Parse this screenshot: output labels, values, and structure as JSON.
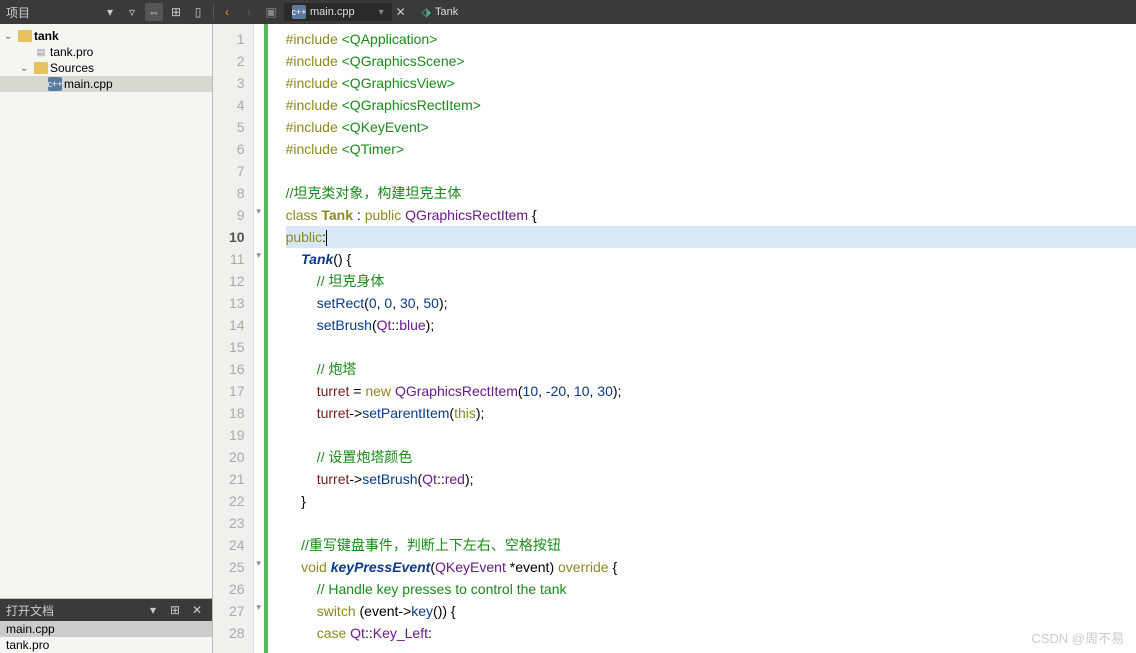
{
  "topbar": {
    "project_label": "项目",
    "nav_back": "‹",
    "nav_fwd": "›",
    "tabs": [
      {
        "icon": "cpp",
        "label": "main.cpp"
      }
    ],
    "symbol_label": "Tank"
  },
  "project_tree": {
    "root": {
      "label": "tank",
      "icon": "folder"
    },
    "children": [
      {
        "label": "tank.pro",
        "icon": "pro",
        "indent": 1
      },
      {
        "label": "Sources",
        "icon": "folder",
        "indent": 1,
        "expanded": true
      },
      {
        "label": "main.cpp",
        "icon": "cpp",
        "indent": 2,
        "selected": true
      }
    ]
  },
  "open_docs": {
    "title": "打开文档",
    "items": [
      {
        "label": "main.cpp",
        "selected": true
      },
      {
        "label": "tank.pro",
        "selected": false
      }
    ]
  },
  "editor": {
    "current_line": 10,
    "lines": [
      {
        "n": 1,
        "tokens": [
          [
            "kw",
            "#include "
          ],
          [
            "inc",
            "<QApplication>"
          ]
        ]
      },
      {
        "n": 2,
        "tokens": [
          [
            "kw",
            "#include "
          ],
          [
            "inc",
            "<QGraphicsScene>"
          ]
        ]
      },
      {
        "n": 3,
        "tokens": [
          [
            "kw",
            "#include "
          ],
          [
            "inc",
            "<QGraphicsView>"
          ]
        ]
      },
      {
        "n": 4,
        "tokens": [
          [
            "kw",
            "#include "
          ],
          [
            "inc",
            "<QGraphicsRectItem>"
          ]
        ]
      },
      {
        "n": 5,
        "tokens": [
          [
            "kw",
            "#include "
          ],
          [
            "inc",
            "<QKeyEvent>"
          ]
        ]
      },
      {
        "n": 6,
        "tokens": [
          [
            "kw",
            "#include "
          ],
          [
            "inc",
            "<QTimer>"
          ]
        ]
      },
      {
        "n": 7,
        "tokens": []
      },
      {
        "n": 8,
        "tokens": [
          [
            "cmt",
            "//坦克类对象，构建坦克主体"
          ]
        ]
      },
      {
        "n": 9,
        "fold": true,
        "tokens": [
          [
            "kw",
            "class "
          ],
          [
            "kw-bold",
            "Tank"
          ],
          [
            "pun",
            " : "
          ],
          [
            "kw",
            "public"
          ],
          [
            "pun",
            " "
          ],
          [
            "type",
            "QGraphicsRectItem"
          ],
          [
            "pun",
            " {"
          ]
        ]
      },
      {
        "n": 10,
        "hl": true,
        "tokens": [
          [
            "kw",
            "public"
          ],
          [
            "pun",
            ":"
          ],
          [
            "cursor",
            ""
          ]
        ]
      },
      {
        "n": 11,
        "fold": true,
        "tokens": [
          [
            "pun",
            "    "
          ],
          [
            "func-bold",
            "Tank"
          ],
          [
            "pun",
            "() {"
          ]
        ]
      },
      {
        "n": 12,
        "tokens": [
          [
            "pun",
            "        "
          ],
          [
            "cmt",
            "// 坦克身体"
          ]
        ]
      },
      {
        "n": 13,
        "tokens": [
          [
            "pun",
            "        "
          ],
          [
            "func",
            "setRect"
          ],
          [
            "pun",
            "("
          ],
          [
            "num",
            "0"
          ],
          [
            "pun",
            ", "
          ],
          [
            "num",
            "0"
          ],
          [
            "pun",
            ", "
          ],
          [
            "num",
            "30"
          ],
          [
            "pun",
            ", "
          ],
          [
            "num",
            "50"
          ],
          [
            "pun",
            ");"
          ]
        ]
      },
      {
        "n": 14,
        "tokens": [
          [
            "pun",
            "        "
          ],
          [
            "func",
            "setBrush"
          ],
          [
            "pun",
            "("
          ],
          [
            "type",
            "Qt"
          ],
          [
            "pun",
            "::"
          ],
          [
            "enum",
            "blue"
          ],
          [
            "pun",
            ");"
          ]
        ]
      },
      {
        "n": 15,
        "tokens": []
      },
      {
        "n": 16,
        "tokens": [
          [
            "pun",
            "        "
          ],
          [
            "cmt",
            "// 炮塔"
          ]
        ]
      },
      {
        "n": 17,
        "tokens": [
          [
            "pun",
            "        "
          ],
          [
            "mem",
            "turret"
          ],
          [
            "pun",
            " = "
          ],
          [
            "kw",
            "new"
          ],
          [
            "pun",
            " "
          ],
          [
            "type",
            "QGraphicsRectItem"
          ],
          [
            "pun",
            "("
          ],
          [
            "num",
            "10"
          ],
          [
            "pun",
            ", "
          ],
          [
            "num",
            "-20"
          ],
          [
            "pun",
            ", "
          ],
          [
            "num",
            "10"
          ],
          [
            "pun",
            ", "
          ],
          [
            "num",
            "30"
          ],
          [
            "pun",
            ");"
          ]
        ]
      },
      {
        "n": 18,
        "tokens": [
          [
            "pun",
            "        "
          ],
          [
            "mem",
            "turret"
          ],
          [
            "pun",
            "->"
          ],
          [
            "func",
            "setParentItem"
          ],
          [
            "pun",
            "("
          ],
          [
            "kw",
            "this"
          ],
          [
            "pun",
            ");"
          ]
        ]
      },
      {
        "n": 19,
        "tokens": []
      },
      {
        "n": 20,
        "tokens": [
          [
            "pun",
            "        "
          ],
          [
            "cmt",
            "// 设置炮塔颜色"
          ]
        ]
      },
      {
        "n": 21,
        "tokens": [
          [
            "pun",
            "        "
          ],
          [
            "mem",
            "turret"
          ],
          [
            "pun",
            "->"
          ],
          [
            "func",
            "setBrush"
          ],
          [
            "pun",
            "("
          ],
          [
            "type",
            "Qt"
          ],
          [
            "pun",
            "::"
          ],
          [
            "enum",
            "red"
          ],
          [
            "pun",
            ");"
          ]
        ]
      },
      {
        "n": 22,
        "tokens": [
          [
            "pun",
            "    }"
          ]
        ]
      },
      {
        "n": 23,
        "tokens": []
      },
      {
        "n": 24,
        "tokens": [
          [
            "pun",
            "    "
          ],
          [
            "cmt",
            "//重写键盘事件，判断上下左右、空格按钮"
          ]
        ]
      },
      {
        "n": 25,
        "fold": true,
        "tokens": [
          [
            "pun",
            "    "
          ],
          [
            "kw",
            "void"
          ],
          [
            "pun",
            " "
          ],
          [
            "func-bold",
            "keyPressEvent"
          ],
          [
            "pun",
            "("
          ],
          [
            "type",
            "QKeyEvent"
          ],
          [
            "pun",
            " *event) "
          ],
          [
            "kw",
            "override"
          ],
          [
            "pun",
            " {"
          ]
        ]
      },
      {
        "n": 26,
        "tokens": [
          [
            "pun",
            "        "
          ],
          [
            "cmt",
            "// Handle key presses to control the tank"
          ]
        ]
      },
      {
        "n": 27,
        "fold": true,
        "tokens": [
          [
            "pun",
            "        "
          ],
          [
            "kw",
            "switch"
          ],
          [
            "pun",
            " (event->"
          ],
          [
            "func",
            "key"
          ],
          [
            "pun",
            "()) {"
          ]
        ]
      },
      {
        "n": 28,
        "tokens": [
          [
            "pun",
            "        "
          ],
          [
            "kw",
            "case"
          ],
          [
            "pun",
            " "
          ],
          [
            "type",
            "Qt"
          ],
          [
            "pun",
            "::"
          ],
          [
            "enum",
            "Key_Left"
          ],
          [
            "pun",
            ":"
          ]
        ]
      }
    ]
  },
  "watermark": "CSDN @周不易"
}
